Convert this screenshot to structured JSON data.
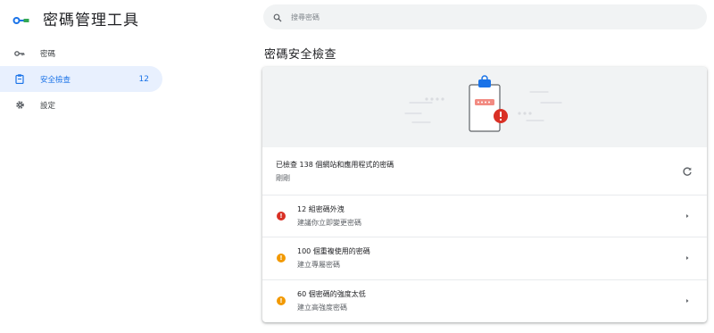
{
  "app": {
    "title": "密碼管理工具"
  },
  "sidebar": {
    "items": [
      {
        "label": "密碼",
        "count": ""
      },
      {
        "label": "安全檢查",
        "count": "12"
      },
      {
        "label": "設定",
        "count": ""
      }
    ]
  },
  "search": {
    "placeholder": "搜尋密碼"
  },
  "main": {
    "title": "密碼安全檢查",
    "status": {
      "line1": "已檢查 138 個網站和應用程式的密碼",
      "line2": "剛剛"
    },
    "issues": [
      {
        "title": "12 組密碼外洩",
        "subtitle": "建議你立即變更密碼",
        "severity": "critical",
        "color": "#d93025"
      },
      {
        "title": "100 個重複使用的密碼",
        "subtitle": "建立專屬密碼",
        "severity": "warning",
        "color": "#f29900"
      },
      {
        "title": "60 個密碼的強度太低",
        "subtitle": "建立高強度密碼",
        "severity": "warning",
        "color": "#f29900"
      }
    ]
  },
  "icons": {
    "logo": "key-logo-icon",
    "nav": [
      "key-icon",
      "clipboard-icon",
      "gear-icon"
    ],
    "search": "search-icon",
    "refresh": "refresh-icon",
    "chevron": "chevron-right-icon"
  },
  "colors": {
    "accent": "#1a73e8",
    "active_bg": "#e8f0fe",
    "critical": "#d93025",
    "warning": "#f29900"
  }
}
